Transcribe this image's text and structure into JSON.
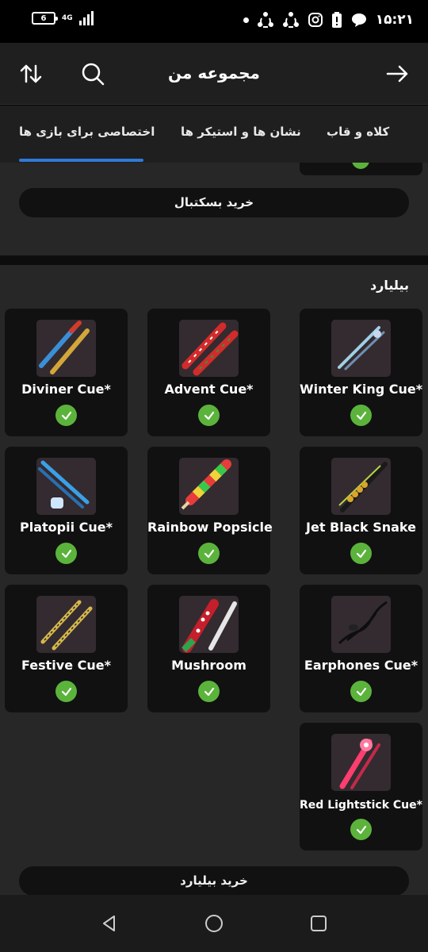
{
  "status_bar": {
    "battery": "6",
    "network": "4G",
    "time": "۱۵:۲۱"
  },
  "header": {
    "title": "مجموعه من",
    "sort_icon": "sort-icon",
    "search_icon": "search-icon",
    "back_icon": "arrow-right-icon"
  },
  "tabs": [
    {
      "label": "اختصاصی برای بازی ها",
      "active": true
    },
    {
      "label": "نشان ها و استیکر ها",
      "active": false
    },
    {
      "label": "کلاه و قاب",
      "active": false
    }
  ],
  "basketball": {
    "buy_label": "خرید بسکتبال"
  },
  "billiards": {
    "title": "بیلیارد",
    "items": [
      {
        "name": "Winter King Cue*",
        "owned": true
      },
      {
        "name": "Advent Cue*",
        "owned": true
      },
      {
        "name": "Diviner Cue*",
        "owned": true
      },
      {
        "name": "Jet Black Snake",
        "owned": true
      },
      {
        "name": "Rainbow Popsicle",
        "owned": true
      },
      {
        "name": "Platopii Cue*",
        "owned": true
      },
      {
        "name": "Earphones Cue*",
        "owned": true
      },
      {
        "name": "Mushroom",
        "owned": true
      },
      {
        "name": "Festive Cue*",
        "owned": true
      },
      {
        "name": "Red Lightstick Cue*",
        "owned": true
      }
    ],
    "buy_label": "خرید بیلیارد"
  },
  "colors": {
    "background": "#272727",
    "card": "#111111",
    "accent": "#2f7ad6",
    "check": "#5bb33c"
  },
  "nav_bar": {
    "back_icon": "nav-back-icon",
    "home_icon": "nav-home-icon",
    "recents_icon": "nav-recents-icon"
  }
}
